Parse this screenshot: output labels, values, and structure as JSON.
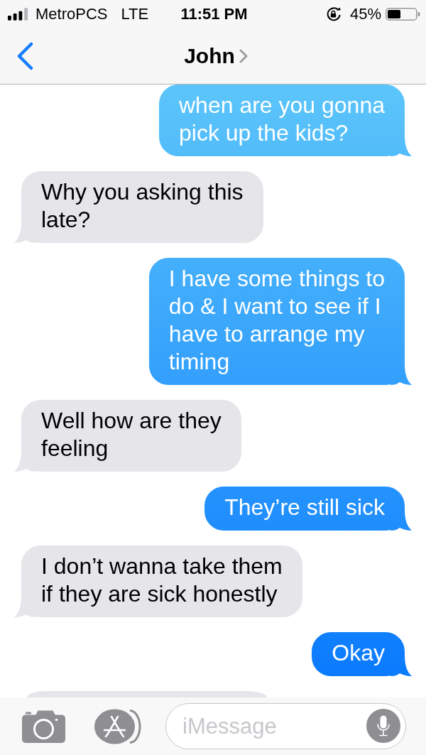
{
  "status_bar": {
    "carrier": "MetroPCS",
    "network": "LTE",
    "time": "11:51 PM",
    "battery": "45%"
  },
  "header": {
    "contact": "John"
  },
  "messages": [
    {
      "kind": "sent",
      "text": "when are you gonna\npick up the kids?"
    },
    {
      "kind": "received",
      "text": "Why you asking this\nlate?"
    },
    {
      "kind": "sent",
      "text": "I have some things to\ndo & I want to see if I\nhave to arrange my\ntiming"
    },
    {
      "kind": "received",
      "text": "Well how are they\nfeeling"
    },
    {
      "kind": "sent",
      "text": "They’re still sick"
    },
    {
      "kind": "received",
      "text": "I don’t wanna take them\nif they are sick honestly"
    },
    {
      "kind": "sent",
      "text": "Okay"
    },
    {
      "kind": "received"
    }
  ],
  "composer": {
    "placeholder": "iMessage"
  }
}
